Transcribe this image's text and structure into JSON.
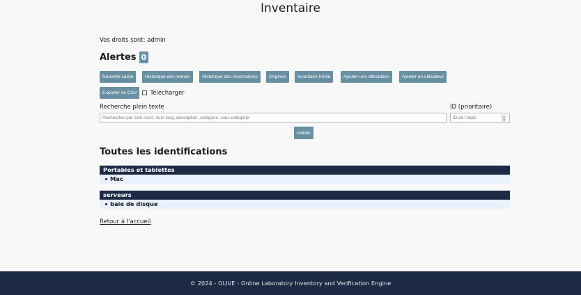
{
  "page": {
    "title": "Inventaire"
  },
  "user": {
    "rights_text": "Vos droits sont: admin"
  },
  "alerts": {
    "title": "Alertes",
    "count": "0"
  },
  "actions": [
    "Nouvelle saisie",
    "Historique des retours",
    "Historique des réservations",
    "Origines",
    "Inventaire hérité",
    "Ajouter une affectation",
    "Ajouter un utilisateur"
  ],
  "export": {
    "button_label": "Exporter en CSV",
    "download_label": "Télécharger"
  },
  "search": {
    "label": "Recherche plein texte",
    "placeholder": "Rechercher par nom court, nom long, description, catégorie, sous-catégorie",
    "id_label": "ID (prioritaire)",
    "id_placeholder": "ID de l'objet",
    "submit_label": "Valider"
  },
  "identifications": {
    "title": "Toutes les identifications",
    "categories": [
      {
        "name": "Portables et tablettes",
        "items": [
          "Mac"
        ]
      },
      {
        "name": "serveurs",
        "items": [
          "baie de disque"
        ]
      }
    ]
  },
  "nav": {
    "back_label": "Retour à l'accueil"
  },
  "footer": {
    "text": "© 2024 - OLIVE - Online Laboratory Inventory and Verification Engine"
  },
  "colors": {
    "button": "#6790a3",
    "header_dark": "#1c2a45",
    "item_bg": "#e8f1fb",
    "background": "#f8f8f8"
  }
}
